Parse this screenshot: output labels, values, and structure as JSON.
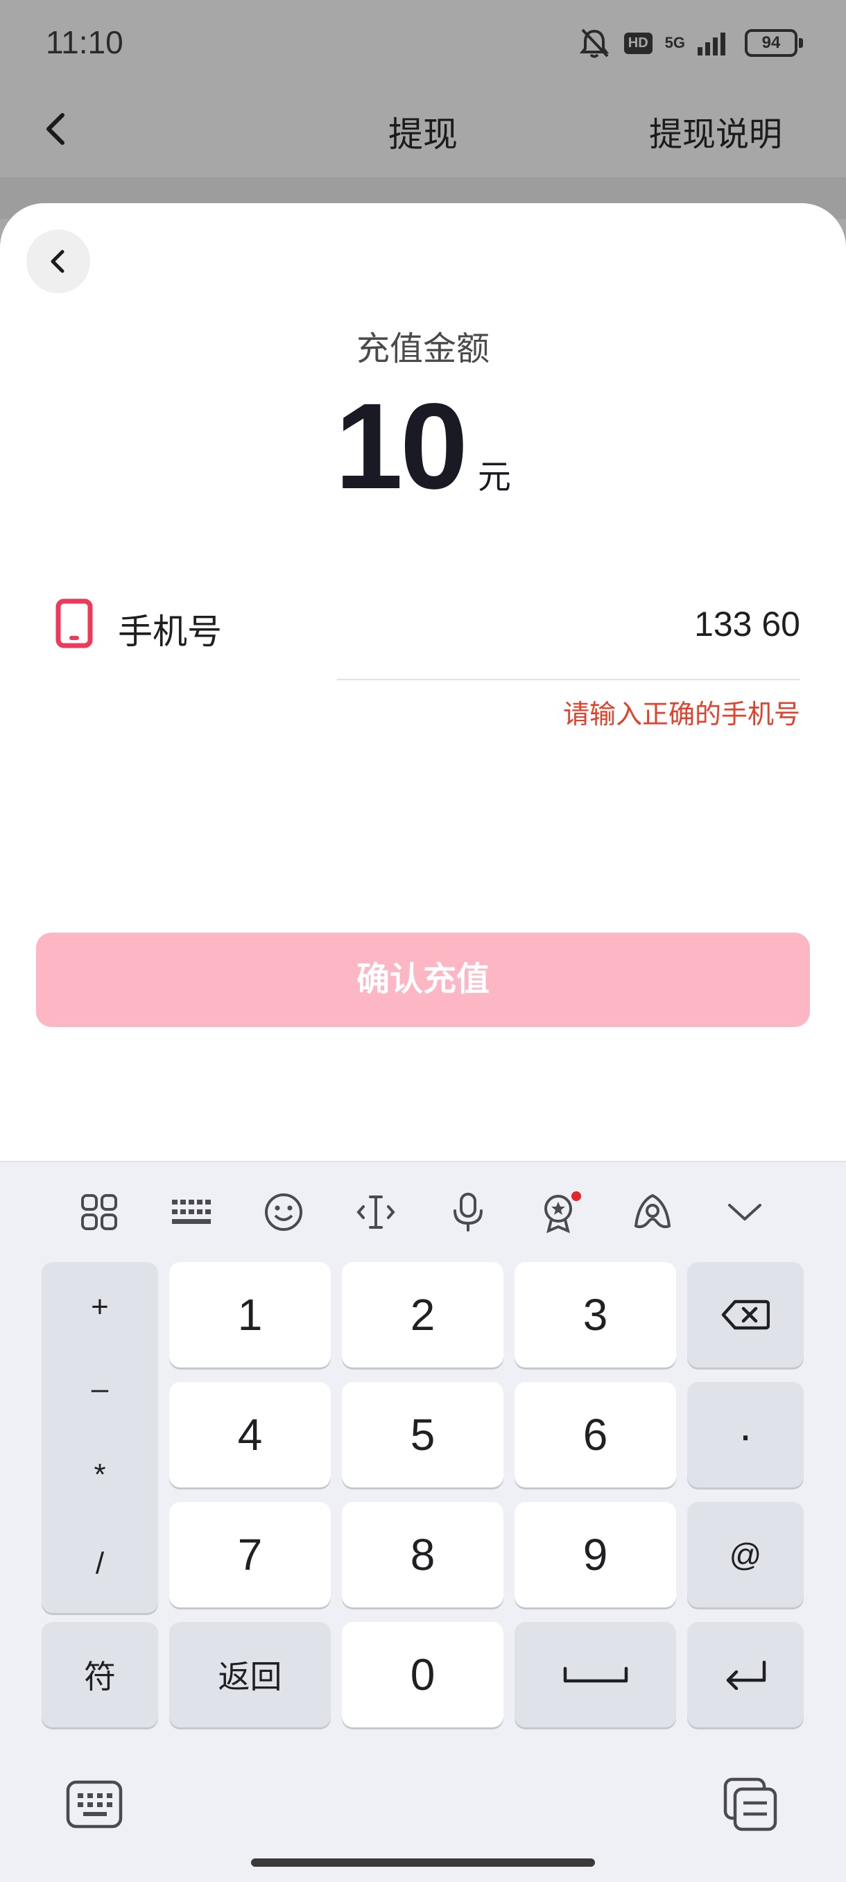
{
  "status": {
    "time": "11:10",
    "network": "5G",
    "hd": "HD",
    "battery": "94"
  },
  "header": {
    "title": "提现",
    "right_link": "提现说明"
  },
  "sheet": {
    "amount_label": "充值金额",
    "amount_value": "10",
    "amount_unit": "元",
    "phone_label": "手机号",
    "phone_value": "133 60",
    "error": "请输入正确的手机号",
    "confirm_label": "确认充值"
  },
  "keyboard": {
    "toolbar_icons": [
      "grid-icon",
      "keyboard-icon",
      "emoji-icon",
      "cursor-icon",
      "mic-icon",
      "badge-icon",
      "assistant-icon",
      "chevron-down-icon"
    ],
    "symbols": [
      "+",
      "–",
      "*",
      "/"
    ],
    "digits": [
      "1",
      "2",
      "3",
      "4",
      "5",
      "6",
      "7",
      "8",
      "9",
      "0"
    ],
    "dot": "·",
    "at": "@",
    "symbol_key": "符",
    "return_key": "返回"
  },
  "colors": {
    "accent": "#fdb6c4",
    "error": "#e2422c",
    "phone_icon": "#ec3b5a"
  }
}
